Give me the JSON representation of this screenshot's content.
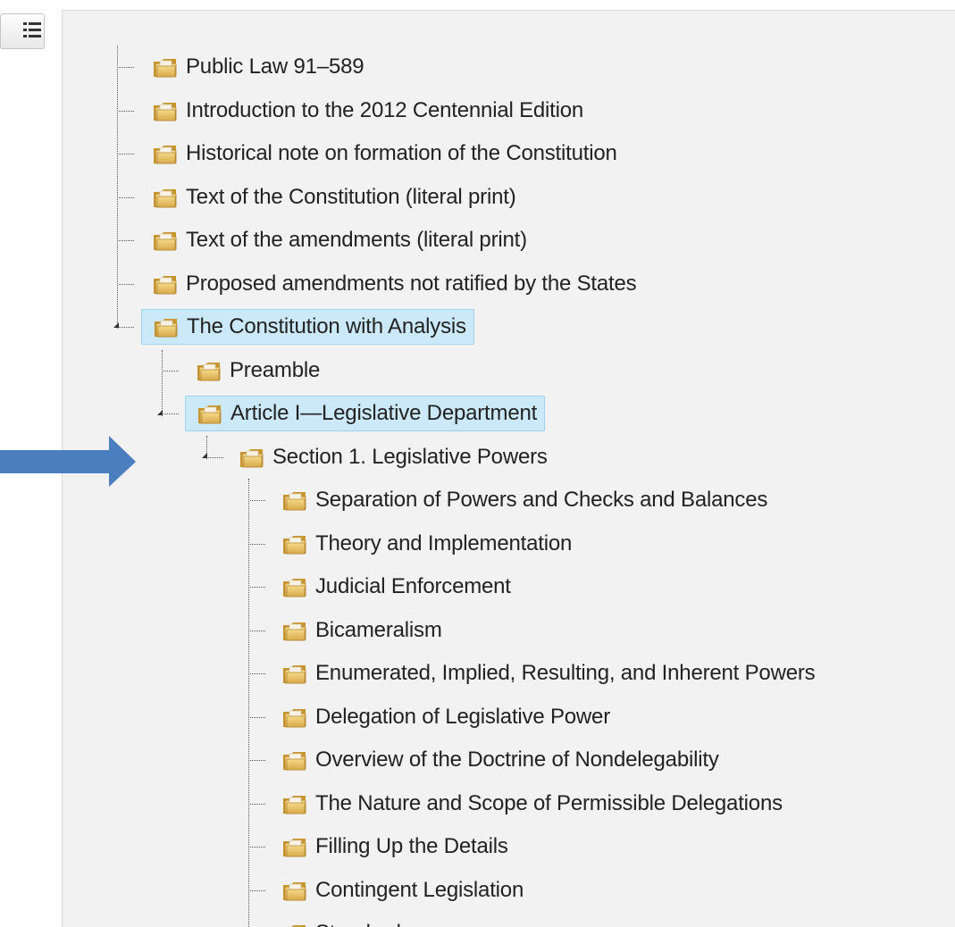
{
  "toolbar": {
    "toc_toggle_icon": "list-icon"
  },
  "tree": {
    "root_items": [
      {
        "label": "Public Law 91–589",
        "icon": "folder-icon"
      },
      {
        "label": "Introduction to the 2012 Centennial Edition",
        "icon": "folder-icon"
      },
      {
        "label": "Historical note on formation of the Constitution",
        "icon": "folder-icon"
      },
      {
        "label": "Text of the Constitution (literal print)",
        "icon": "folder-icon"
      },
      {
        "label": "Text of the amendments (literal print)",
        "icon": "folder-icon"
      },
      {
        "label": "Proposed amendments not ratified by the States",
        "icon": "folder-icon"
      },
      {
        "label": "The Constitution with Analysis",
        "icon": "folder-icon",
        "expanded": true,
        "selected": true
      }
    ],
    "constitution_children": [
      {
        "label": "Preamble",
        "icon": "folder-icon"
      },
      {
        "label": "Article I—Legislative Department",
        "icon": "folder-icon",
        "expanded": true,
        "selected": true
      }
    ],
    "article1_children": [
      {
        "label": "Section 1. Legislative Powers",
        "icon": "folder-icon",
        "expanded": true
      }
    ],
    "section1_children": [
      {
        "label": "Separation of Powers and Checks and Balances",
        "icon": "folder-icon"
      },
      {
        "label": "Theory and Implementation",
        "icon": "folder-icon"
      },
      {
        "label": "Judicial Enforcement",
        "icon": "folder-icon"
      },
      {
        "label": "Bicameralism",
        "icon": "folder-icon"
      },
      {
        "label": "Enumerated, Implied, Resulting, and Inherent Powers",
        "icon": "folder-icon"
      },
      {
        "label": "Delegation of Legislative Power",
        "icon": "folder-icon"
      },
      {
        "label": "Overview of the Doctrine of Nondelegability",
        "icon": "folder-icon"
      },
      {
        "label": "The Nature and Scope of Permissible Delegations",
        "icon": "folder-icon"
      },
      {
        "label": "Filling Up the Details",
        "icon": "folder-icon"
      },
      {
        "label": "Contingent Legislation",
        "icon": "folder-icon"
      },
      {
        "label": "Standards",
        "icon": "folder-icon"
      }
    ]
  },
  "annotation": {
    "icon": "right-arrow-icon",
    "color": "#4a7ebf"
  },
  "colors": {
    "selected_bg": "#cbe9f9",
    "selected_border": "#9dd3ef",
    "panel_bg": "#f2f2f2"
  }
}
